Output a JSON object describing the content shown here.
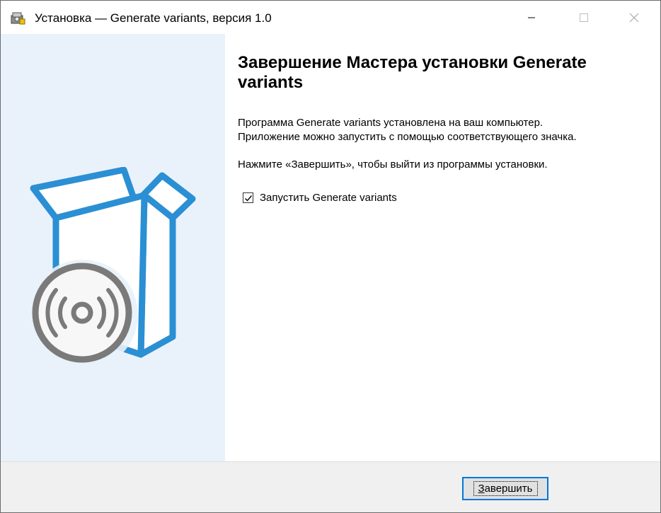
{
  "window": {
    "title": "Установка — Generate variants, версия 1.0",
    "icons": {
      "app": "installer-icon",
      "minimize": "minimize-icon",
      "maximize": "maximize-icon",
      "close": "close-icon"
    }
  },
  "sidebar": {
    "illustration": "software-box-disc-illustration"
  },
  "content": {
    "heading": "Завершение Мастера установки Generate variants",
    "line1": "Программа Generate variants установлена на ваш компьютер.",
    "line2": "Приложение можно запустить с помощью соответствующего значка.",
    "line3": "Нажмите «Завершить», чтобы выйти из программы установки.",
    "launch_checkbox": {
      "label": "Запустить Generate variants",
      "checked": true
    }
  },
  "footer": {
    "finish_label": "Завершить",
    "finish_accelerator": "З",
    "finish_rest": "авершить"
  },
  "colors": {
    "sidebar_bg": "#e9f2fa",
    "accent": "#0078d7",
    "box_blue": "#2b8fd4",
    "disc_gray": "#7a7a7a"
  }
}
